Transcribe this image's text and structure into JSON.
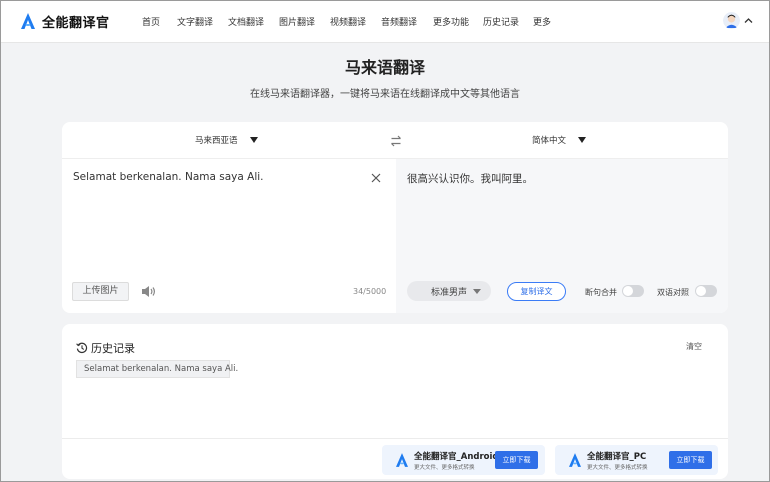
{
  "app": {
    "name": "全能翻译官"
  },
  "nav": [
    {
      "label": "首页"
    },
    {
      "label": "文字翻译"
    },
    {
      "label": "文档翻译"
    },
    {
      "label": "图片翻译"
    },
    {
      "label": "视频翻译"
    },
    {
      "label": "音频翻译"
    },
    {
      "label": "更多功能"
    },
    {
      "label": "历史记录"
    },
    {
      "label": "更多"
    }
  ],
  "page": {
    "title": "马来语翻译",
    "subtitle": "在线马来语翻译器，一键将马来语在线翻译成中文等其他语言"
  },
  "translator": {
    "source_lang": "马来西亚语",
    "target_lang": "简体中文",
    "source_text": "Selamat berkenalan. Nama saya Ali.",
    "output_text": "很高兴认识你。我叫阿里。",
    "upload_label": "上传图片",
    "char_count": "34/5000",
    "voice": "标准男声",
    "copy_label": "复制译文",
    "toggle_merge": "断句合并",
    "toggle_bilingual": "双语对照"
  },
  "history": {
    "title": "历史记录",
    "clear_label": "清空",
    "items": [
      {
        "text": "Selamat berkenalan. Nama saya Ali."
      }
    ]
  },
  "downloads": [
    {
      "name": "全能翻译官_Android",
      "desc": "更大文件、更多格式转换",
      "button": "立即下载"
    },
    {
      "name": "全能翻译官_PC",
      "desc": "更大文件、更多格式转换",
      "button": "立即下载"
    }
  ],
  "colors": {
    "accent": "#2f6fe8",
    "logo": "#1f7cf0"
  }
}
